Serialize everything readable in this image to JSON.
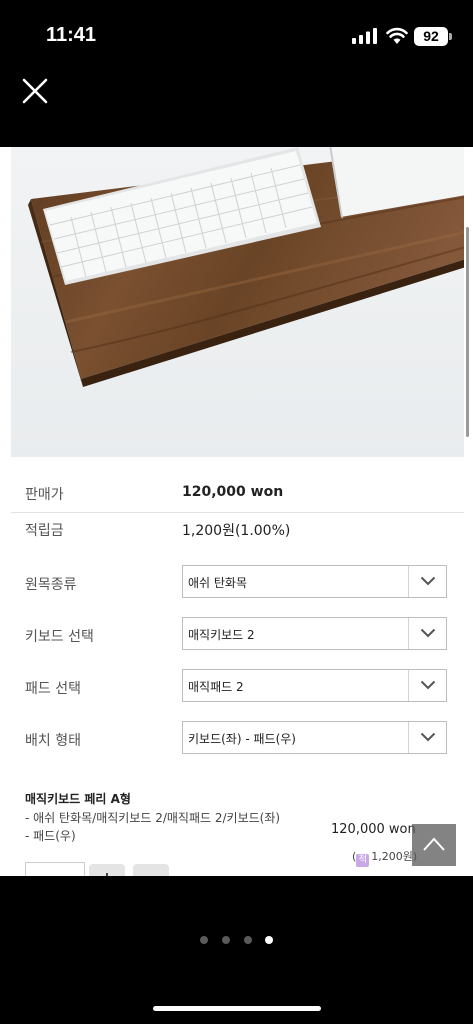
{
  "status_bar": {
    "time": "11:41",
    "battery": "92",
    "icons": [
      "signal-icon",
      "wifi-icon",
      "battery-icon"
    ]
  },
  "viewer": {
    "close_icon": "close-icon",
    "pages": 4,
    "active_page": 4
  },
  "product": {
    "price_label": "판매가",
    "price_value": "120,000 won",
    "points_label": "적립금",
    "points_value": "1,200원(1.00%)"
  },
  "options": [
    {
      "label": "원목종류",
      "value": "애쉬 탄화목"
    },
    {
      "label": "키보드 선택",
      "value": "매직키보드 2"
    },
    {
      "label": "패드 선택",
      "value": "매직패드 2"
    },
    {
      "label": "배치 형태",
      "value": "키보드(좌) - 패드(우)"
    }
  ],
  "selected_item": {
    "title": "매직키보드 페리 A형",
    "description": "- 애쉬 탄화목/매직키보드 2/매직패드 2/키보드(좌) - 패드(우)",
    "price": "120,000 won",
    "points": "(",
    "points_amount": "1,200원)",
    "points_badge": "적"
  },
  "colors": {
    "wood": "#6b4526",
    "background": "#000000",
    "accent_badge": "#c9a8e6"
  }
}
